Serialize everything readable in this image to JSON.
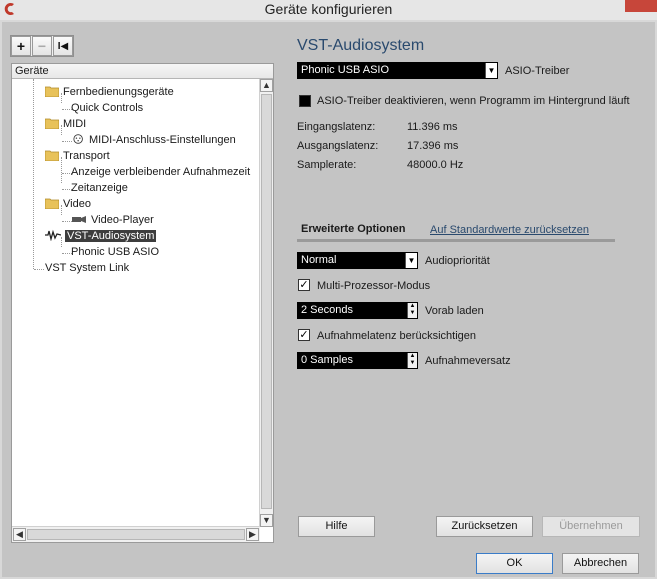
{
  "window": {
    "title": "Geräte konfigurieren"
  },
  "toolbar": {
    "add": "+",
    "remove": "−",
    "reset": "I◀"
  },
  "tree": {
    "header": "Geräte",
    "items": [
      {
        "label": "Fernbedienungsgeräte"
      },
      {
        "label": "Quick Controls"
      },
      {
        "label": "MIDI"
      },
      {
        "label": "MIDI-Anschluss-Einstellungen"
      },
      {
        "label": "Transport"
      },
      {
        "label": "Anzeige verbleibender Aufnahmezeit"
      },
      {
        "label": "Zeitanzeige"
      },
      {
        "label": "Video"
      },
      {
        "label": "Video-Player"
      },
      {
        "label": "VST-Audiosystem"
      },
      {
        "label": "Phonic USB ASIO"
      },
      {
        "label": "VST System Link"
      }
    ]
  },
  "panel": {
    "heading": "VST-Audiosystem",
    "driver_select": "Phonic USB ASIO",
    "driver_label": "ASIO-Treiber",
    "deactivate_label": "ASIO-Treiber deaktivieren, wenn Programm im Hintergrund läuft",
    "input_latency_label": "Eingangslatenz:",
    "input_latency_value": "11.396 ms",
    "output_latency_label": "Ausgangslatenz:",
    "output_latency_value": "17.396 ms",
    "samplerate_label": "Samplerate:",
    "samplerate_value": "48000.0 Hz",
    "tab_advanced": "Erweiterte Optionen",
    "tab_reset_defaults": "Auf Standardwerte zurücksetzen",
    "audio_priority_value": "Normal",
    "audio_priority_label": "Audiopriorität",
    "multiprocessor_label": "Multi-Prozessor-Modus",
    "preload_value": "2 Seconds",
    "preload_label": "Vorab laden",
    "rec_latency_label": "Aufnahmelatenz berücksichtigen",
    "rec_offset_value": "0 Samples",
    "rec_offset_label": "Aufnahmeversatz"
  },
  "buttons": {
    "help": "Hilfe",
    "reset": "Zurücksetzen",
    "apply": "Übernehmen",
    "ok": "OK",
    "cancel": "Abbrechen"
  },
  "colors": {
    "heading": "#2a4a6e",
    "selection": "#3d3d3d",
    "accent_close": "#c7463a"
  }
}
